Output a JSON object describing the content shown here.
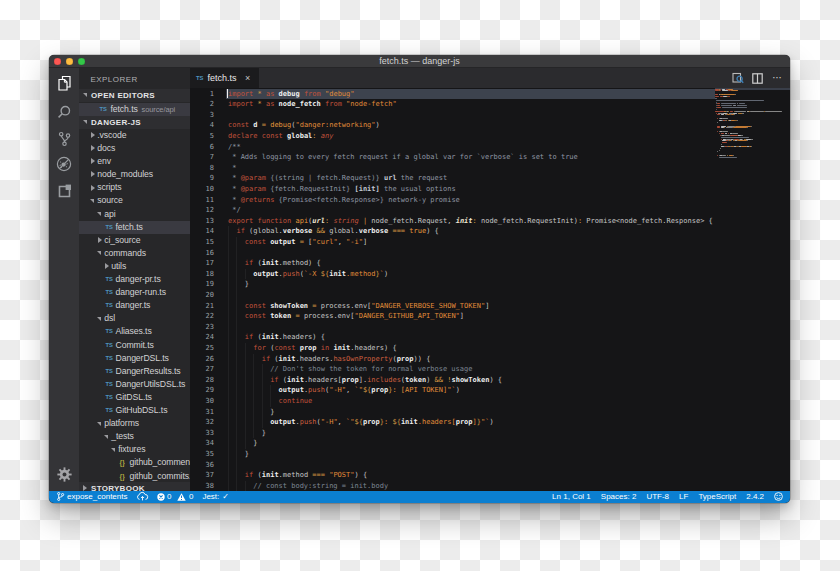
{
  "background": {
    "checker_light": "#ffffff",
    "checker_dark": "#ececec",
    "cell_size": 20
  },
  "window": {
    "title": "fetch.ts — danger-js",
    "traffic_lights": {
      "close": "#fc5753",
      "minimize": "#fdbc40",
      "zoom": "#33c748"
    }
  },
  "activity_bar": {
    "items": [
      {
        "name": "explorer",
        "icon": "files-icon",
        "active": true
      },
      {
        "name": "search",
        "icon": "search-icon",
        "active": false
      },
      {
        "name": "source-control",
        "icon": "git-branch-icon",
        "active": false
      },
      {
        "name": "debug",
        "icon": "debug-icon",
        "active": false
      },
      {
        "name": "extensions",
        "icon": "extensions-icon",
        "active": false
      }
    ],
    "settings_icon": "gear-icon"
  },
  "sidebar": {
    "title": "EXPLORER",
    "open_editors_header": "OPEN EDITORS",
    "open_editors": [
      {
        "icon": "TS",
        "label": "fetch.ts",
        "description": "source/api",
        "selected": true
      }
    ],
    "folder_header": "DANGER-JS",
    "tree": [
      {
        "type": "folder",
        "label": ".vscode",
        "level": 0,
        "expanded": false
      },
      {
        "type": "folder",
        "label": "docs",
        "level": 0,
        "expanded": false
      },
      {
        "type": "folder",
        "label": "env",
        "level": 0,
        "expanded": false
      },
      {
        "type": "folder",
        "label": "node_modules",
        "level": 0,
        "expanded": false
      },
      {
        "type": "folder",
        "label": "scripts",
        "level": 0,
        "expanded": false
      },
      {
        "type": "folder",
        "label": "source",
        "level": 0,
        "expanded": true
      },
      {
        "type": "folder",
        "label": "api",
        "level": 1,
        "expanded": true
      },
      {
        "type": "file",
        "label": "fetch.ts",
        "level": 2,
        "icon": "TS",
        "selected": true
      },
      {
        "type": "folder",
        "label": "ci_source",
        "level": 1,
        "expanded": false
      },
      {
        "type": "folder",
        "label": "commands",
        "level": 1,
        "expanded": true
      },
      {
        "type": "folder",
        "label": "utils",
        "level": 2,
        "expanded": false
      },
      {
        "type": "file",
        "label": "danger-pr.ts",
        "level": 2,
        "icon": "TS"
      },
      {
        "type": "file",
        "label": "danger-run.ts",
        "level": 2,
        "icon": "TS"
      },
      {
        "type": "file",
        "label": "danger.ts",
        "level": 2,
        "icon": "TS"
      },
      {
        "type": "folder",
        "label": "dsl",
        "level": 1,
        "expanded": true
      },
      {
        "type": "file",
        "label": "Aliases.ts",
        "level": 2,
        "icon": "TS"
      },
      {
        "type": "file",
        "label": "Commit.ts",
        "level": 2,
        "icon": "TS"
      },
      {
        "type": "file",
        "label": "DangerDSL.ts",
        "level": 2,
        "icon": "TS"
      },
      {
        "type": "file",
        "label": "DangerResults.ts",
        "level": 2,
        "icon": "TS"
      },
      {
        "type": "file",
        "label": "DangerUtilsDSL.ts",
        "level": 2,
        "icon": "TS"
      },
      {
        "type": "file",
        "label": "GitDSL.ts",
        "level": 2,
        "icon": "TS"
      },
      {
        "type": "file",
        "label": "GitHubDSL.ts",
        "level": 2,
        "icon": "TS"
      },
      {
        "type": "folder",
        "label": "platforms",
        "level": 1,
        "expanded": true
      },
      {
        "type": "folder",
        "label": "_tests",
        "level": 2,
        "expanded": true
      },
      {
        "type": "folder",
        "label": "fixtures",
        "level": 3,
        "expanded": true
      },
      {
        "type": "file",
        "label": "github_commen..",
        "level": 4,
        "icon": "{}"
      },
      {
        "type": "file",
        "label": "github_commits..",
        "level": 4,
        "icon": "{}"
      }
    ],
    "bottom_section_header": "STORYBOOK"
  },
  "editor": {
    "tab": {
      "icon": "TS",
      "label": "fetch.ts",
      "close": "×",
      "active": true
    },
    "actions": [
      {
        "name": "open-preview",
        "icon": "preview-icon"
      },
      {
        "name": "split-editor",
        "icon": "split-editor-icon"
      },
      {
        "name": "more-actions",
        "icon": "ellipsis-icon",
        "glyph": "⋯"
      }
    ],
    "active_line": 1,
    "code_lines": [
      [
        [
          "k",
          "import"
        ],
        [
          "t",
          " "
        ],
        [
          "o",
          "*"
        ],
        [
          "t",
          " "
        ],
        [
          "k",
          "as"
        ],
        [
          "t",
          " "
        ],
        [
          "i",
          "debug"
        ],
        [
          "t",
          " "
        ],
        [
          "k",
          "from"
        ],
        [
          "t",
          " "
        ],
        [
          "s",
          "\"debug\""
        ]
      ],
      [
        [
          "k",
          "import"
        ],
        [
          "t",
          " "
        ],
        [
          "o",
          "*"
        ],
        [
          "t",
          " "
        ],
        [
          "k",
          "as"
        ],
        [
          "t",
          " "
        ],
        [
          "i",
          "node_fetch"
        ],
        [
          "t",
          " "
        ],
        [
          "k",
          "from"
        ],
        [
          "t",
          " "
        ],
        [
          "s",
          "\"node-fetch\""
        ]
      ],
      [],
      [
        [
          "k",
          "const"
        ],
        [
          "t",
          " "
        ],
        [
          "i",
          "d"
        ],
        [
          "t",
          " "
        ],
        [
          "o",
          "="
        ],
        [
          "t",
          " "
        ],
        [
          "a",
          "debug"
        ],
        [
          "t",
          "("
        ],
        [
          "s",
          "\"danger:networking\""
        ],
        [
          "t",
          ")"
        ]
      ],
      [
        [
          "k",
          "declare"
        ],
        [
          "t",
          " "
        ],
        [
          "k",
          "const"
        ],
        [
          "t",
          " "
        ],
        [
          "i",
          "global"
        ],
        [
          "o",
          ":"
        ],
        [
          "t",
          " "
        ],
        [
          "y",
          "any"
        ]
      ],
      [
        [
          "c",
          "/**"
        ]
      ],
      [
        [
          "c",
          " * Adds logging to every fetch request if a global var for `verbose` is set to true"
        ]
      ],
      [
        [
          "c",
          " *"
        ]
      ],
      [
        [
          "c",
          " * "
        ],
        [
          "k",
          "@param"
        ],
        [
          "c",
          " {(string | fetch.Request)} "
        ],
        [
          "d",
          "url"
        ],
        [
          "c",
          " the request"
        ]
      ],
      [
        [
          "c",
          " * "
        ],
        [
          "k",
          "@param"
        ],
        [
          "c",
          " {fetch.RequestInit} "
        ],
        [
          "d",
          "[init]"
        ],
        [
          "c",
          " the usual options"
        ]
      ],
      [
        [
          "c",
          " * "
        ],
        [
          "k",
          "@returns"
        ],
        [
          "c",
          " {Promise<fetch.Response>} network-y promise"
        ]
      ],
      [
        [
          "c",
          " */"
        ]
      ],
      [
        [
          "k",
          "export"
        ],
        [
          "t",
          " "
        ],
        [
          "k",
          "function"
        ],
        [
          "t",
          " "
        ],
        [
          "a",
          "api"
        ],
        [
          "t",
          "("
        ],
        [
          "p",
          "url"
        ],
        [
          "o",
          ":"
        ],
        [
          "t",
          " "
        ],
        [
          "y",
          "string"
        ],
        [
          "t",
          " "
        ],
        [
          "o",
          "|"
        ],
        [
          "t",
          " node_fetch.Request, "
        ],
        [
          "p",
          "init"
        ],
        [
          "o",
          ":"
        ],
        [
          "t",
          " node_fetch.RequestInit)"
        ],
        [
          "o",
          ":"
        ],
        [
          "t",
          " Promise<node_fetch.Response> {"
        ]
      ],
      [
        [
          "t",
          "  "
        ],
        [
          "k",
          "if"
        ],
        [
          "t",
          " (global."
        ],
        [
          "i",
          "verbose"
        ],
        [
          "t",
          " "
        ],
        [
          "o",
          "&&"
        ],
        [
          "t",
          " global."
        ],
        [
          "i",
          "verbose"
        ],
        [
          "t",
          " "
        ],
        [
          "o",
          "==="
        ],
        [
          "t",
          " "
        ],
        [
          "a",
          "true"
        ],
        [
          "t",
          ") {"
        ]
      ],
      [
        [
          "t",
          "    "
        ],
        [
          "k",
          "const"
        ],
        [
          "t",
          " "
        ],
        [
          "i",
          "output"
        ],
        [
          "t",
          " "
        ],
        [
          "o",
          "="
        ],
        [
          "t",
          " ["
        ],
        [
          "s",
          "\"curl\""
        ],
        [
          "t",
          ", "
        ],
        [
          "s",
          "\"-i\""
        ],
        [
          "t",
          "]"
        ]
      ],
      [],
      [
        [
          "t",
          "    "
        ],
        [
          "k",
          "if"
        ],
        [
          "t",
          " ("
        ],
        [
          "i",
          "init"
        ],
        [
          "t",
          ".method) {"
        ]
      ],
      [
        [
          "t",
          "      "
        ],
        [
          "i",
          "output"
        ],
        [
          "t",
          "."
        ],
        [
          "f",
          "push"
        ],
        [
          "t",
          "("
        ],
        [
          "s",
          "`-X "
        ],
        [
          "o",
          "${"
        ],
        [
          "i",
          "init"
        ],
        [
          "s",
          ".method"
        ],
        [
          "o",
          "}"
        ],
        [
          "s",
          "`"
        ],
        [
          "t",
          ")"
        ]
      ],
      [
        [
          "t",
          "    }"
        ]
      ],
      [],
      [
        [
          "t",
          "    "
        ],
        [
          "k",
          "const"
        ],
        [
          "t",
          " "
        ],
        [
          "i",
          "showToken"
        ],
        [
          "t",
          " "
        ],
        [
          "o",
          "="
        ],
        [
          "t",
          " process.env["
        ],
        [
          "s",
          "\"DANGER_VERBOSE_SHOW_TOKEN\""
        ],
        [
          "t",
          "]"
        ]
      ],
      [
        [
          "t",
          "    "
        ],
        [
          "k",
          "const"
        ],
        [
          "t",
          " "
        ],
        [
          "i",
          "token"
        ],
        [
          "t",
          " "
        ],
        [
          "o",
          "="
        ],
        [
          "t",
          " process.env["
        ],
        [
          "s",
          "\"DANGER_GITHUB_API_TOKEN\""
        ],
        [
          "t",
          "]"
        ]
      ],
      [],
      [
        [
          "t",
          "    "
        ],
        [
          "k",
          "if"
        ],
        [
          "t",
          " ("
        ],
        [
          "i",
          "init"
        ],
        [
          "t",
          ".headers) {"
        ]
      ],
      [
        [
          "t",
          "      "
        ],
        [
          "k",
          "for"
        ],
        [
          "t",
          " ("
        ],
        [
          "k",
          "const"
        ],
        [
          "t",
          " "
        ],
        [
          "i",
          "prop"
        ],
        [
          "t",
          " "
        ],
        [
          "k",
          "in"
        ],
        [
          "t",
          " "
        ],
        [
          "i",
          "init"
        ],
        [
          "t",
          ".headers) {"
        ]
      ],
      [
        [
          "t",
          "        "
        ],
        [
          "k",
          "if"
        ],
        [
          "t",
          " ("
        ],
        [
          "i",
          "init"
        ],
        [
          "t",
          ".headers."
        ],
        [
          "f",
          "hasOwnProperty"
        ],
        [
          "t",
          "("
        ],
        [
          "i",
          "prop"
        ],
        [
          "t",
          ")) {"
        ]
      ],
      [
        [
          "t",
          "          "
        ],
        [
          "c2",
          "// Don't show the token for normal verbose usage"
        ]
      ],
      [
        [
          "t",
          "          "
        ],
        [
          "k",
          "if"
        ],
        [
          "t",
          " ("
        ],
        [
          "i",
          "init"
        ],
        [
          "t",
          ".headers["
        ],
        [
          "i",
          "prop"
        ],
        [
          "t",
          "]."
        ],
        [
          "f",
          "includes"
        ],
        [
          "t",
          "("
        ],
        [
          "i",
          "token"
        ],
        [
          "t",
          ") "
        ],
        [
          "o",
          "&&"
        ],
        [
          "t",
          " "
        ],
        [
          "o",
          "!"
        ],
        [
          "i",
          "showToken"
        ],
        [
          "t",
          ") {"
        ]
      ],
      [
        [
          "t",
          "            "
        ],
        [
          "i",
          "output"
        ],
        [
          "t",
          "."
        ],
        [
          "f",
          "push"
        ],
        [
          "t",
          "("
        ],
        [
          "s",
          "\"-H\""
        ],
        [
          "t",
          ", "
        ],
        [
          "s",
          "`\""
        ],
        [
          "o",
          "${"
        ],
        [
          "i",
          "prop"
        ],
        [
          "o",
          "}"
        ],
        [
          "s",
          ": [API TOKEN]\"`"
        ],
        [
          "t",
          ")"
        ]
      ],
      [
        [
          "t",
          "            "
        ],
        [
          "k",
          "continue"
        ]
      ],
      [
        [
          "t",
          "          }"
        ]
      ],
      [
        [
          "t",
          "          "
        ],
        [
          "i",
          "output"
        ],
        [
          "t",
          "."
        ],
        [
          "f",
          "push"
        ],
        [
          "t",
          "("
        ],
        [
          "s",
          "\"-H\""
        ],
        [
          "t",
          ", "
        ],
        [
          "s",
          "`\""
        ],
        [
          "o",
          "${"
        ],
        [
          "i",
          "prop"
        ],
        [
          "o",
          "}"
        ],
        [
          "s",
          ": "
        ],
        [
          "o",
          "${"
        ],
        [
          "i",
          "init"
        ],
        [
          "s",
          ".headers["
        ],
        [
          "i",
          "prop"
        ],
        [
          "s",
          "]"
        ],
        [
          "o",
          "}"
        ],
        [
          "s",
          "\"`"
        ],
        [
          "t",
          ")"
        ]
      ],
      [
        [
          "t",
          "        }"
        ]
      ],
      [
        [
          "t",
          "      }"
        ]
      ],
      [
        [
          "t",
          "    }"
        ]
      ],
      [],
      [
        [
          "t",
          "    "
        ],
        [
          "k",
          "if"
        ],
        [
          "t",
          " ("
        ],
        [
          "i",
          "init"
        ],
        [
          "t",
          ".method "
        ],
        [
          "o",
          "==="
        ],
        [
          "t",
          " "
        ],
        [
          "s",
          "\"POST\""
        ],
        [
          "t",
          ") {"
        ]
      ],
      [
        [
          "t",
          "      "
        ],
        [
          "c2",
          "// const body:string = init.body"
        ]
      ]
    ]
  },
  "status_bar": {
    "left": {
      "branch_label": "expose_contents",
      "errors": "0",
      "warnings": "0",
      "jest_label": "Jest:",
      "jest_check": "✓"
    },
    "right": {
      "cursor_position": "Ln 1, Col 1",
      "indentation": "Spaces: 2",
      "encoding": "UTF-8",
      "eol": "LF",
      "language": "TypeScript",
      "version": "2.4.2"
    }
  },
  "colors": {
    "status_bar": "#0b7fd1",
    "editor_bg": "#151517",
    "sidebar_bg": "#272729",
    "activity_bar_bg": "#343437",
    "title_bar_bg": "#3a3a3c",
    "selection_row": "#3a3a41",
    "current_line": "#3d434e",
    "keyword": "#c1523b",
    "string": "#e08c3a",
    "operator": "#d79a43",
    "identifier": "#ededed",
    "comment": "#8f96a3",
    "ts_icon": "#4f94bf",
    "json_icon": "#b3a942"
  }
}
